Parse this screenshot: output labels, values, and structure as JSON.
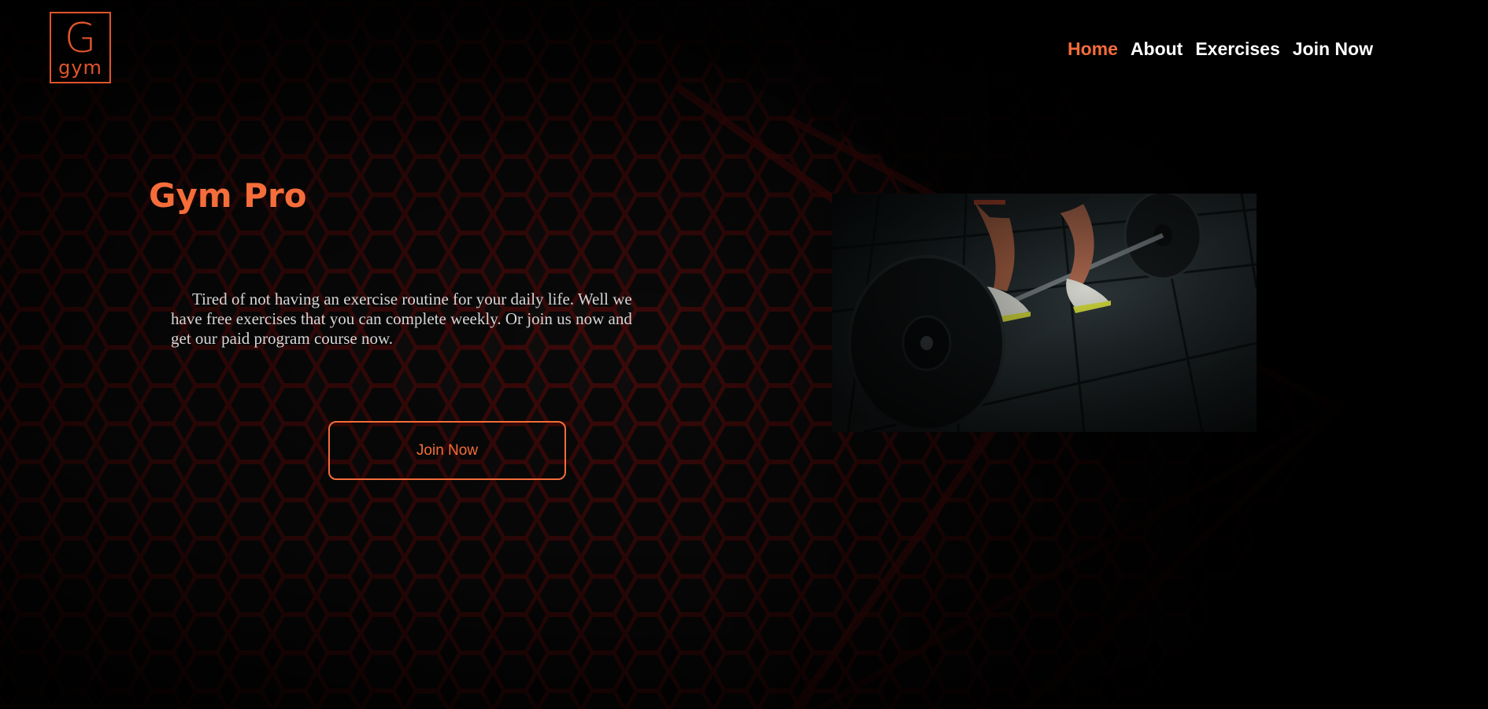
{
  "brand": {
    "logo_letter": "G",
    "logo_word": "gym"
  },
  "nav": {
    "items": [
      {
        "label": "Home",
        "active": true
      },
      {
        "label": "About",
        "active": false
      },
      {
        "label": "Exercises",
        "active": false
      },
      {
        "label": "Join Now",
        "active": false
      }
    ]
  },
  "hero": {
    "title": "Gym Pro",
    "description": "Tired of not having an exercise routine for your daily life. Well we have free exercises that you can complete weekly. Or join us now and get our paid program course now.",
    "cta_label": "Join Now",
    "image_icon": "barbell-deadlift-photo"
  },
  "colors": {
    "accent": "#f46d3a",
    "logo": "#e0552b",
    "background": "#070707",
    "hex_pattern": "#5a0d0d",
    "nav_text": "#ffffff"
  }
}
